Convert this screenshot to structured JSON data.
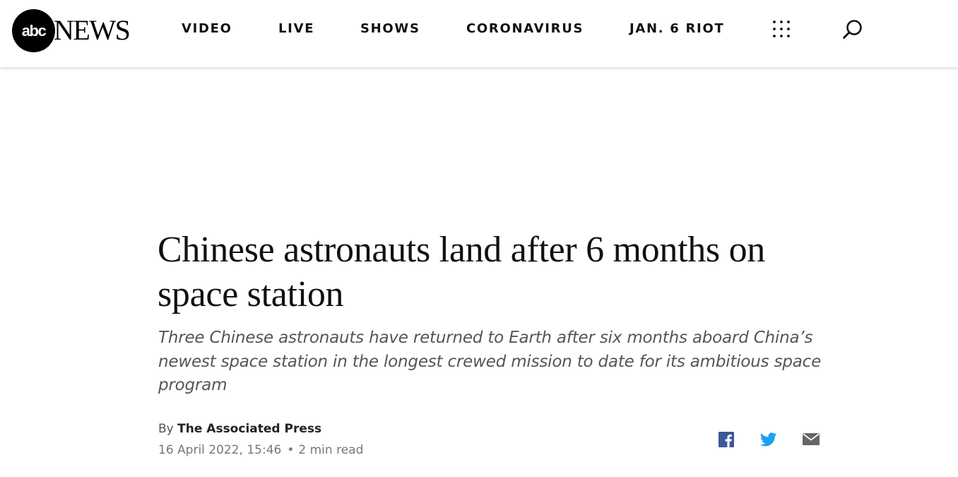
{
  "header": {
    "logo": {
      "mark": "abc",
      "word": "NEWS"
    },
    "nav": [
      {
        "label": "VIDEO"
      },
      {
        "label": "LIVE"
      },
      {
        "label": "SHOWS"
      },
      {
        "label": "CORONAVIRUS"
      },
      {
        "label": "JAN. 6 RIOT"
      }
    ],
    "icons": {
      "menu": "grid-dots-icon",
      "search": "search-icon"
    }
  },
  "article": {
    "headline": "Chinese astronauts land after 6 months on space station",
    "subheadline": "Three Chinese astronauts have returned to Earth after six months aboard China’s newest space station in the longest crewed mission to date for its ambitious space program",
    "byline_prefix": "By",
    "author": "The Associated Press",
    "date": "16 April 2022, 15:46",
    "separator": "•",
    "read_time": "2 min read"
  },
  "share": {
    "icons": [
      "facebook-icon",
      "twitter-icon",
      "email-icon"
    ],
    "colors": {
      "facebook": "#3b5998",
      "twitter": "#1da1f2",
      "email": "#666666"
    }
  }
}
